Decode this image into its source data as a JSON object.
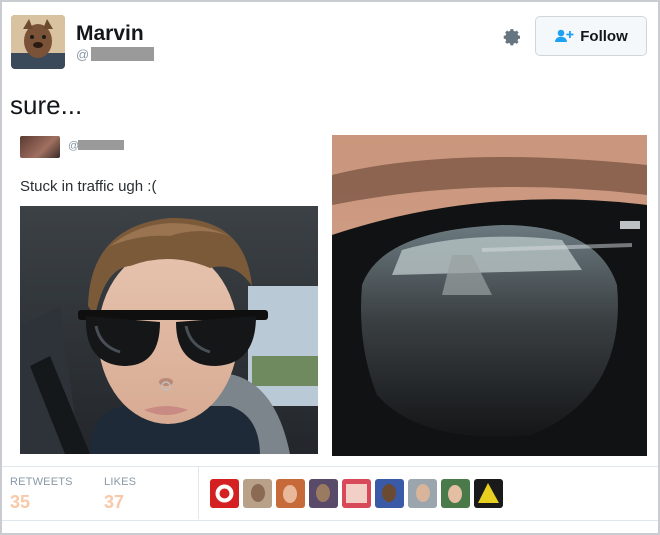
{
  "user": {
    "display_name": "Marvin",
    "handle_prefix": "@"
  },
  "actions": {
    "follow_label": "Follow"
  },
  "tweet": {
    "text": "sure..."
  },
  "embedded": {
    "handle_prefix": "@",
    "text": "Stuck in traffic ugh :("
  },
  "stats": {
    "retweets_label": "RETWEETS",
    "retweets_count": "35",
    "likes_label": "LIKES",
    "likes_count": "37"
  },
  "likers_count": 9,
  "colors": {
    "follow_icon": "#1da1f2",
    "count_text": "#f7c9a8",
    "muted_text": "#8899a6",
    "border": "#e1e8ed"
  }
}
